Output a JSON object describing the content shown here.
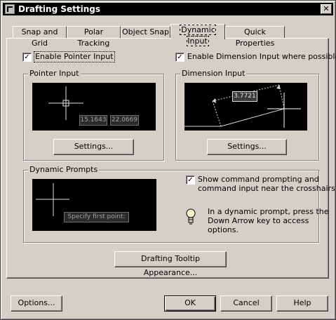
{
  "window": {
    "title": "Drafting Settings",
    "close_glyph": "✕"
  },
  "tabs": [
    {
      "label": "Snap and Grid"
    },
    {
      "label": "Polar Tracking"
    },
    {
      "label": "Object Snap"
    },
    {
      "label": "Dynamic Input"
    },
    {
      "label": "Quick Properties"
    }
  ],
  "dynamic_input": {
    "enable_pointer": {
      "label": "Enable Pointer Input",
      "checked": true
    },
    "enable_dimension": {
      "label": "Enable Dimension Input where possible",
      "checked": true
    },
    "pointer_input": {
      "title": "Pointer Input",
      "x_value": "15.1643",
      "y_value": "22.0669",
      "settings_label": "Settings..."
    },
    "dimension_input": {
      "title": "Dimension Input",
      "value": "3.7721",
      "settings_label": "Settings..."
    },
    "dynamic_prompts": {
      "title": "Dynamic Prompts",
      "prompt_text": "Specify first point:",
      "show_prompting_label_line1": "Show command prompting and",
      "show_prompting_label_line2": "command input near the crosshairs",
      "show_prompting_checked": true,
      "hint_line1": "In a dynamic prompt, press the",
      "hint_line2": "Down Arrow key to access",
      "hint_line3": "options."
    },
    "tooltip_appearance_label": "Drafting Tooltip Appearance..."
  },
  "footer": {
    "options_label": "Options...",
    "ok_label": "OK",
    "cancel_label": "Cancel",
    "help_label": "Help"
  },
  "icons": {
    "check": "✓",
    "hint": "lightbulb-icon"
  },
  "colors": {
    "preview_bg": "#000000",
    "dialog_bg": "#d4d0c8",
    "titlebar_bg": "#000000"
  }
}
